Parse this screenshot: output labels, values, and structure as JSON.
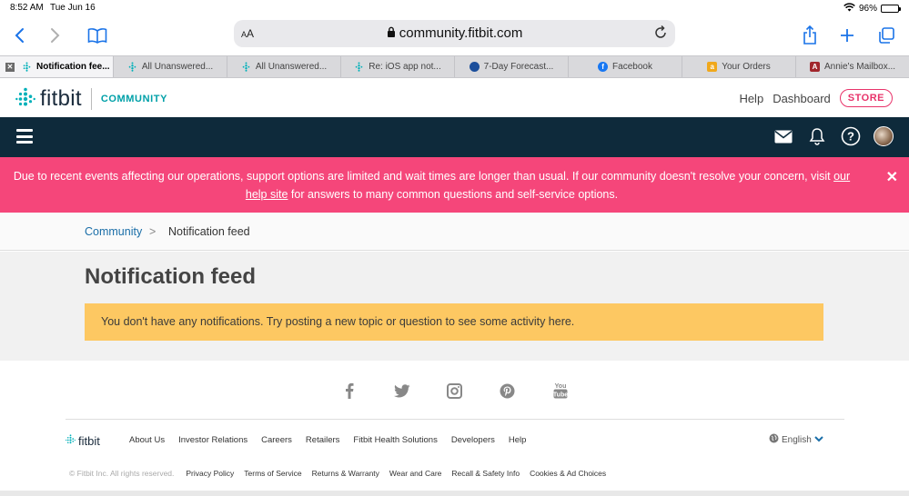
{
  "status_bar": {
    "time": "8:52 AM",
    "date": "Tue Jun 16",
    "battery": "96%"
  },
  "browser": {
    "url": "community.fitbit.com",
    "text_size_label": "AA",
    "tabs": [
      {
        "label": "Notification fee...",
        "active": true,
        "favicon": "fitbit-favicon"
      },
      {
        "label": "All Unanswered...",
        "favicon": "fitbit-favicon"
      },
      {
        "label": "All Unanswered...",
        "favicon": "fitbit-favicon"
      },
      {
        "label": "Re: iOS app not...",
        "favicon": "fitbit-favicon"
      },
      {
        "label": "7-Day Forecast...",
        "favicon": "weather-favicon"
      },
      {
        "label": "Facebook",
        "favicon": "facebook-favicon"
      },
      {
        "label": "Your Orders",
        "favicon": "amazon-favicon"
      },
      {
        "label": "Annie's Mailbox...",
        "favicon": "a-favicon"
      }
    ]
  },
  "site_header": {
    "logo_text": "fitbit",
    "community_label": "COMMUNITY",
    "links": {
      "help": "Help",
      "dashboard": "Dashboard",
      "store": "STORE"
    }
  },
  "alert": {
    "text_before": "Due to recent events affecting our operations, support options are limited and wait times are longer than usual. If our community doesn't resolve your concern, visit ",
    "link_text": "our help site",
    "text_after": " for answers to many common questions and self-service options.",
    "close": "✕"
  },
  "breadcrumb": {
    "root": "Community",
    "separator": ">",
    "current": "Notification feed"
  },
  "main": {
    "title": "Notification feed",
    "notice": "You don't have any notifications. Try posting a new topic or question to see some activity here."
  },
  "footer": {
    "logo_text": "fitbit",
    "links": [
      "About Us",
      "Investor Relations",
      "Careers",
      "Retailers",
      "Fitbit Health Solutions",
      "Developers",
      "Help"
    ],
    "language": "English",
    "copyright": "© Fitbit Inc. All rights reserved.",
    "legal_links": [
      "Privacy Policy",
      "Terms of Service",
      "Returns & Warranty",
      "Wear and Care",
      "Recall & Safety Info",
      "Cookies & Ad Choices"
    ]
  },
  "colors": {
    "nav_bg": "#0e2a3b",
    "alert_bg": "#f5467a",
    "notice_bg": "#fdc862",
    "brand_teal": "#00a0a8",
    "store_pink": "#e8336a",
    "link_blue": "#1a6ea8"
  }
}
